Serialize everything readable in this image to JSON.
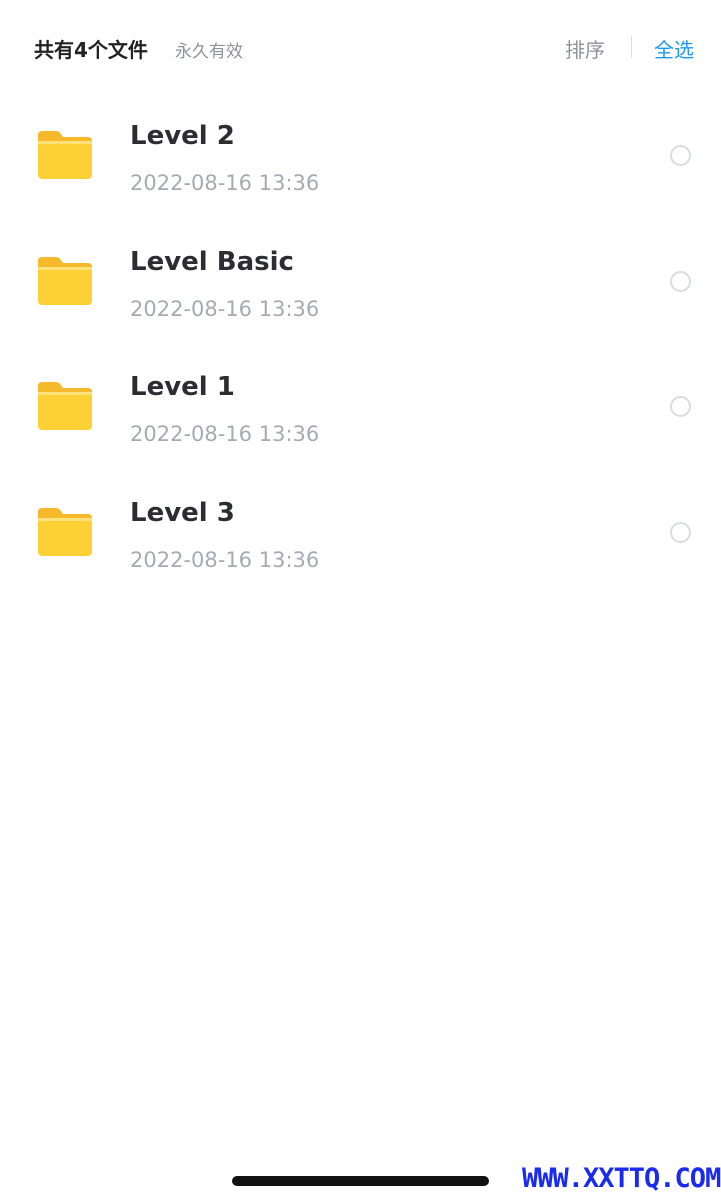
{
  "header": {
    "file_count": "共有4个文件",
    "validity": "永久有效",
    "sort_label": "排序",
    "select_all_label": "全选"
  },
  "files": [
    {
      "name": "Level 2",
      "date": "2022-08-16 13:36",
      "icon": "folder-icon",
      "selected": false
    },
    {
      "name": "Level Basic",
      "date": "2022-08-16 13:36",
      "icon": "folder-icon",
      "selected": false
    },
    {
      "name": "Level 1",
      "date": "2022-08-16 13:36",
      "icon": "folder-icon",
      "selected": false
    },
    {
      "name": "Level 3",
      "date": "2022-08-16 13:36",
      "icon": "folder-icon",
      "selected": false
    }
  ],
  "watermark": "WWW.XXTTQ.COM",
  "colors": {
    "accent": "#1d9bf0",
    "folder": "#fdd136",
    "folder_tab": "#f7b92c",
    "watermark": "#1a2bf0"
  }
}
